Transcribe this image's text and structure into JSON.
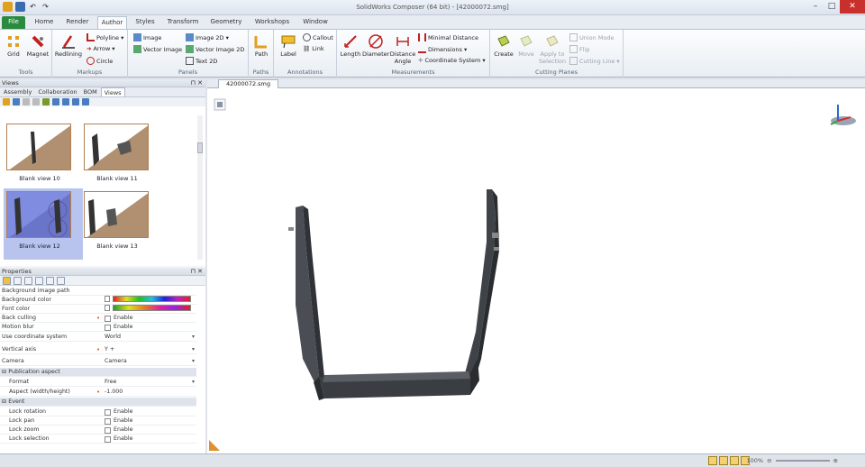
{
  "window": {
    "title": "SolidWorks Composer (64 bit) - [42000072.smg]"
  },
  "tabs": [
    {
      "label": "File"
    },
    {
      "label": "Home"
    },
    {
      "label": "Render"
    },
    {
      "label": "Author"
    },
    {
      "label": "Styles"
    },
    {
      "label": "Transform"
    },
    {
      "label": "Geometry"
    },
    {
      "label": "Workshops"
    },
    {
      "label": "Window"
    }
  ],
  "ribbon": {
    "tools": {
      "label": "Tools",
      "grid": "Grid",
      "magnet": "Magnet"
    },
    "markups": {
      "label": "Markups",
      "redlining": "Redlining",
      "polyline": "Polyline",
      "arrow": "Arrow",
      "circle": "Circle"
    },
    "panels": {
      "label": "Panels",
      "image": "Image",
      "vector_image": "Vector Image",
      "image2d": "Image 2D",
      "vector_image2d": "Vector Image 2D",
      "text2d": "Text 2D"
    },
    "paths": {
      "label": "Paths",
      "path": "Path"
    },
    "annotations": {
      "label": "Annotations",
      "label_btn": "Label",
      "callout": "Callout",
      "link": "Link"
    },
    "measurements": {
      "label": "Measurements",
      "length": "Length",
      "diameter": "Diameter",
      "distance": "Distance",
      "angle": "Angle",
      "minimal_distance": "Minimal Distance",
      "dimensions": "Dimensions",
      "coordinate_system": "Coordinate System"
    },
    "cutting": {
      "label": "Cutting Planes",
      "create": "Create",
      "move": "Move",
      "apply": "Apply to Selection",
      "union": "Union Mode",
      "flip": "Flip",
      "cutting_line": "Cutting Line"
    }
  },
  "views_panel": {
    "title": "Views",
    "tabs": [
      "Assembly",
      "Collaboration",
      "BOM",
      "Views"
    ],
    "thumbnails": [
      "Blank view 10",
      "Blank view 11",
      "Blank view 12",
      "Blank view 13"
    ]
  },
  "properties": {
    "title": "Properties",
    "rows": [
      {
        "name": "Background image path",
        "value": ""
      },
      {
        "name": "Background color",
        "value": ""
      },
      {
        "name": "Font color",
        "value": ""
      },
      {
        "name": "Back culling",
        "value": "Enable"
      },
      {
        "name": "Motion blur",
        "value": "Enable"
      },
      {
        "name": "Use coordinate system",
        "value": "World"
      },
      {
        "name": "Vertical axis",
        "value": "Y +"
      },
      {
        "name": "Camera",
        "value": "Camera"
      },
      {
        "name": "Publication aspect",
        "value": ""
      },
      {
        "name": "Format",
        "value": "Free"
      },
      {
        "name": "Aspect (width/height)",
        "value": "-1.000"
      },
      {
        "name": "Event",
        "value": ""
      },
      {
        "name": "Lock rotation",
        "value": "Enable"
      },
      {
        "name": "Lock pan",
        "value": "Enable"
      },
      {
        "name": "Lock zoom",
        "value": "Enable"
      },
      {
        "name": "Lock selection",
        "value": "Enable"
      }
    ]
  },
  "document": {
    "tab": "42000072.smg"
  },
  "status": {
    "zoom": "100%"
  }
}
